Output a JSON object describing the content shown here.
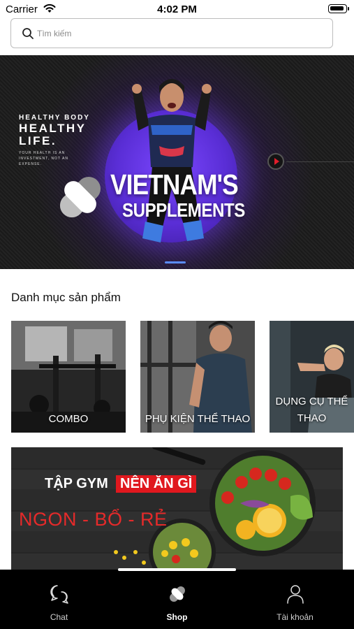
{
  "status_bar": {
    "carrier": "Carrier",
    "time": "4:02 PM"
  },
  "search": {
    "placeholder": "Tìm kiếm",
    "value": ""
  },
  "hero": {
    "tag_small": "HEALTHY BODY",
    "tag_big": "HEALTHY LIFE.",
    "tag_tiny": "YOUR HEALTH IS AN INVESTMENT, NOT AN EXPENSE.",
    "brand_line1": "VIETNAM'S",
    "brand_line2": "SUPPLEMENTS"
  },
  "categories": {
    "title": "Danh mục sản phẩm",
    "items": [
      {
        "label": "COMBO"
      },
      {
        "label": "PHỤ KIỆN THỂ THAO"
      },
      {
        "label": "DỤNG CỤ THỂ THAO"
      }
    ]
  },
  "promo": {
    "title_part1": "TẬP GYM",
    "title_part2": "NÊN ĂN GÌ",
    "subtitle": "NGON - BỔ - RẺ"
  },
  "tab_bar": {
    "active": "Shop",
    "tabs": [
      {
        "label": "Chat",
        "icon": "chat-icon"
      },
      {
        "label": "Shop",
        "icon": "pill-icon"
      },
      {
        "label": "Tài khoản",
        "icon": "user-icon"
      }
    ]
  },
  "colors": {
    "accent_red": "#e0181e",
    "hero_purple": "#5a2ed6",
    "tab_bar_bg": "#000000"
  }
}
